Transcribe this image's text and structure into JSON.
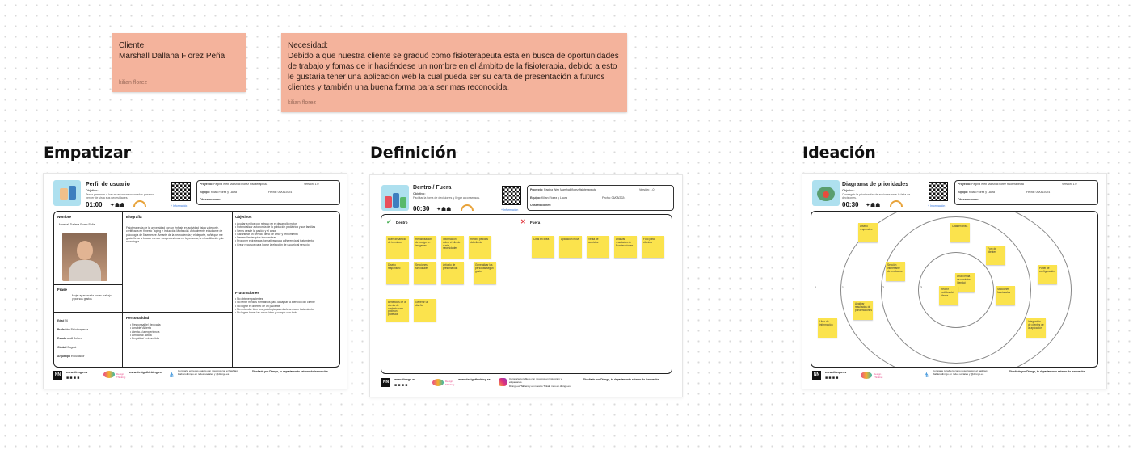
{
  "sticky_client": {
    "label": "Cliente:",
    "name": "Marshall Dallana Florez Peña",
    "author": "kilian florez"
  },
  "sticky_need": {
    "label": "Necesidad:",
    "text": "Debido a que nuestra cliente se graduó como fisioterapeuta esta en busca de oportunidades de trabajo y fomas de ir haciéndese un nombre en el ámbito de la fisioterapia, debido a esto le gustaria tener una aplicacion web la cual pueda ser su carta de presentación a futuros clientes y también una buena forma para ser mas reconocida.",
    "author": "kilian florez"
  },
  "sections": {
    "empatizar": "Empatizar",
    "definicion": "Definición",
    "ideacion": "Ideación"
  },
  "empatizar_board": {
    "title": "Perfil de usuario",
    "objective_label": "Objetivo:",
    "objective_text": "Tener presente a los usuarios seleccionados para no perder de vista sus necesidades.",
    "timer": "01:00",
    "project": "Proyecto:",
    "project_val": "Pagina Web Marshall Florez Fisioterapeuta",
    "version": "Versión: 1.0",
    "team": "Equipo:",
    "team_val": "Kilian Florez y Laura",
    "date": "Fecha: 06/08/2024",
    "obs": "Observaciones:",
    "qr_link": "+ Información",
    "name_h": "Nombre",
    "name_v": "Marshall Dallana Florez Peña",
    "bio_h": "Biografía",
    "bio_v": "Fisioterapeuta de la universidad con un énfasis en actividad física y deporte, certificada en Kinesio Taping e Inducción Miofascial. Actualmente estudiante de psicología de 5 semestre. Amante de la neurociencia y el deporte, soñé que me guste llevar a buscar ejercer sus profesiones en la persona, la rehabilitación y la neurología.",
    "goals_h": "Objetivos",
    "goals_v": "• Ayudar a niños con retraso en el desarrollo motor\n• Potencializar autonomía de la población pediátrica y sus familias\n• Seres desde la pasión y el amor\n• Garantizar un servicio lleno de amor y rendimiento\n• Desarrollar terapias innovadoras\n• Proponer estrategias formativas para adherencia al tratamiento\n• Crear recursos para lograr la elección de usuario al servicio",
    "phrase_h": "Frase",
    "phrase_v": "Mujer apasionada por su trabajo y por sus gustos",
    "frus_h": "Frustraciones",
    "frus_v": "• No obtener pacientes\n• No tener medios formativos para la captar la atención del cliente\n• No lograr el objetivo de un paciente\n• No entender bien una patología para darle un buen tratamiento\n• No lograr hacer las cosas bien y cumplir con todo",
    "age": "Edad",
    "age_v": "26",
    "prof": "Profesión",
    "prof_v": "Fisioterapeuta",
    "civil": "Estado civil",
    "civil_v": "Soltera",
    "city": "Ciudad",
    "city_v": "Bogotá",
    "arch": "Arquetipo",
    "arch_v": "el cuidador",
    "pers_h": "Personalidad",
    "pers_v": "• Responsable/ dedicada\n• Amable/ Abierta\n• Atenta a la experiencia\n• Amistosa/ activa\n• Empática/ extrovertida",
    "footer_site": "www.dinngo.es",
    "footer_brand": "Design Thinking",
    "footer_site2": "www.designthinking.es",
    "footer_share": "Comparte en redes cuanto con nosotros con el hashtag #tablerodinngo en redes sociales y @dinngo.es",
    "footer_design": "Diseñado por Dinngo, tu departamento externo de innovación."
  },
  "definicion_board": {
    "title": "Dentro / Fuera",
    "objective_label": "Objetivo:",
    "objective_text": "Facilitar la toma de decisiones y llegar a consensos.",
    "timer": "00:30",
    "project": "Proyecto:",
    "project_val": "Pagina Web Marshall florez fisioterapeuta",
    "version": "Versión: 1.0",
    "team": "Equipo:",
    "team_val": "Kilian Florez y Laura",
    "date": "Fecha: 06/08/2024",
    "obs": "Observaciones:",
    "qr_link": "+ Información",
    "inside": "Dentro",
    "outside": "Fuera",
    "inside_notes": [
      "Buen desarrollo de terminos",
      "Rehabilitacion de codigo en imagenes",
      "Informacion sobre el cliente a mis necesidades",
      "Recibir pedidos del cliente",
      "Diseño responsivo",
      "Secciones funcionales",
      "Artículo de presentación",
      "Generalizar las personas según gusto",
      "Beneficios de la clienta de contrato para pedir un profesion",
      "Generar un diseño"
    ],
    "outside_notes": [
      "Citas en linea",
      "Aplicación móvil",
      "Venta de servicios",
      "Analizar resultados de Ponderaciones",
      "Foro para clientes"
    ],
    "footer_site": "www.dinngo.es",
    "footer_brand": "Design Thinking",
    "footer_site2": "www.designthinking.es",
    "footer_share": "Comparte tu tablero con nosotros en Instagram y etiquetanos.",
    "footer_share2": "Dinngo.es/Tablero y en nuestro Tinkab más en dinngo.es",
    "footer_design": "Diseñado por Dinngo, tu departamento externo de innovación."
  },
  "ideacion_board": {
    "title": "Diagrama de prioridades",
    "objective_label": "Objetivo:",
    "objective_text": "Conseguir la priorización de acciones ante la falta de decisiones.",
    "timer": "00:30",
    "project": "Proyecto:",
    "project_val": "Pagina Web Marshall florez fisioterapeuta",
    "version": "Versión: 1.0",
    "team": "Equipo:",
    "team_val": "Kilian Florez y Laura",
    "date": "Fecha: 06/08/2024",
    "obs": "Observaciones:",
    "qr_link": "+ Información",
    "axis": [
      "0",
      "1",
      "2",
      "3"
    ],
    "notes": [
      "Diseño responsivo",
      "Citas en linea",
      "Foro de clientes",
      "Panel de configuración",
      "Sección interesante de productos",
      "Una Tienda de servicios (tienda)",
      "Recibir pedidos del cliente",
      "Secciones funcionales",
      "Integración de clientes de la aplicación",
      "Libro de información",
      "Analizar resultados de ponderaciones"
    ],
    "footer_site": "www.dinngo.es",
    "footer_brand": "Design Thinking",
    "footer_share": "Comparte tu tablero como nosotros con el hashtag #tablerodinngo en redes sociales y @dinngo.es",
    "footer_design": "Diseñado por Dinngo, tu departamento externo de innovación."
  },
  "colors": {
    "sticky": "#f4b39c",
    "note": "#fbe34d",
    "tile": "#aee0ef"
  }
}
